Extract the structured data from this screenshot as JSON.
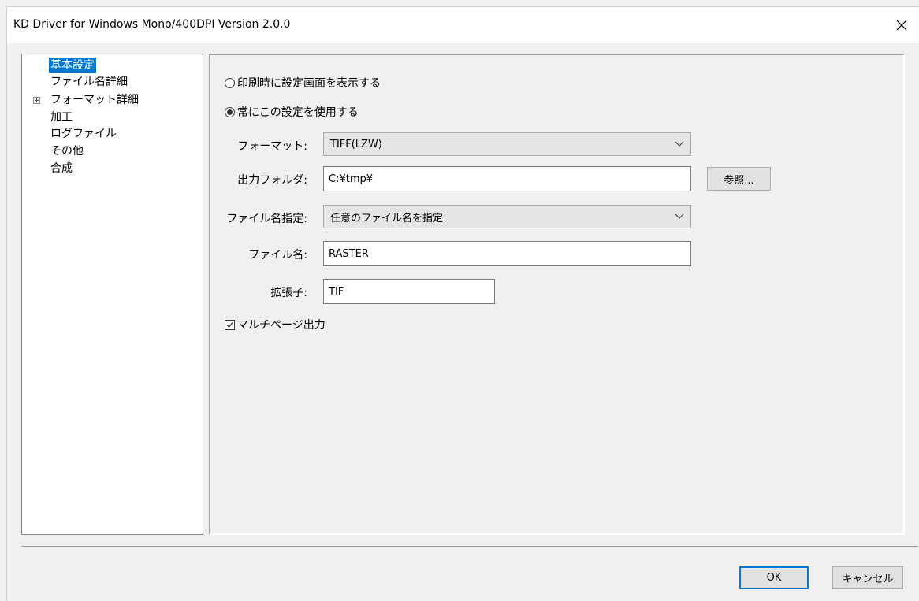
{
  "window": {
    "title": "KD Driver for Windows Mono/400DPI Version 2.0.0"
  },
  "tree": {
    "items": [
      {
        "label": "基本設定"
      },
      {
        "label": "ファイル名詳細"
      },
      {
        "label": "フォーマット詳細"
      },
      {
        "label": "加工"
      },
      {
        "label": "ログファイル"
      },
      {
        "label": "その他"
      },
      {
        "label": "合成"
      }
    ]
  },
  "main": {
    "radio_show_dialog": "印刷時に設定画面を表示する",
    "radio_use_settings": "常にこの設定を使用する",
    "format_label": "フォーマット:",
    "format_value": "TIFF(LZW)",
    "output_folder_label": "出力フォルダ:",
    "output_folder_value": "C:¥tmp¥",
    "browse_button": "参照...",
    "filename_mode_label": "ファイル名指定:",
    "filename_mode_value": "任意のファイル名を指定",
    "filename_label": "ファイル名:",
    "filename_value": "RASTER",
    "extension_label": "拡張子:",
    "extension_value": "TIF",
    "multipage_label": "マルチページ出力"
  },
  "footer": {
    "ok_label": "OK",
    "cancel_label": "キャンセル"
  },
  "colors": {
    "selection": "#0078d7",
    "panel": "#f0f0f0"
  }
}
